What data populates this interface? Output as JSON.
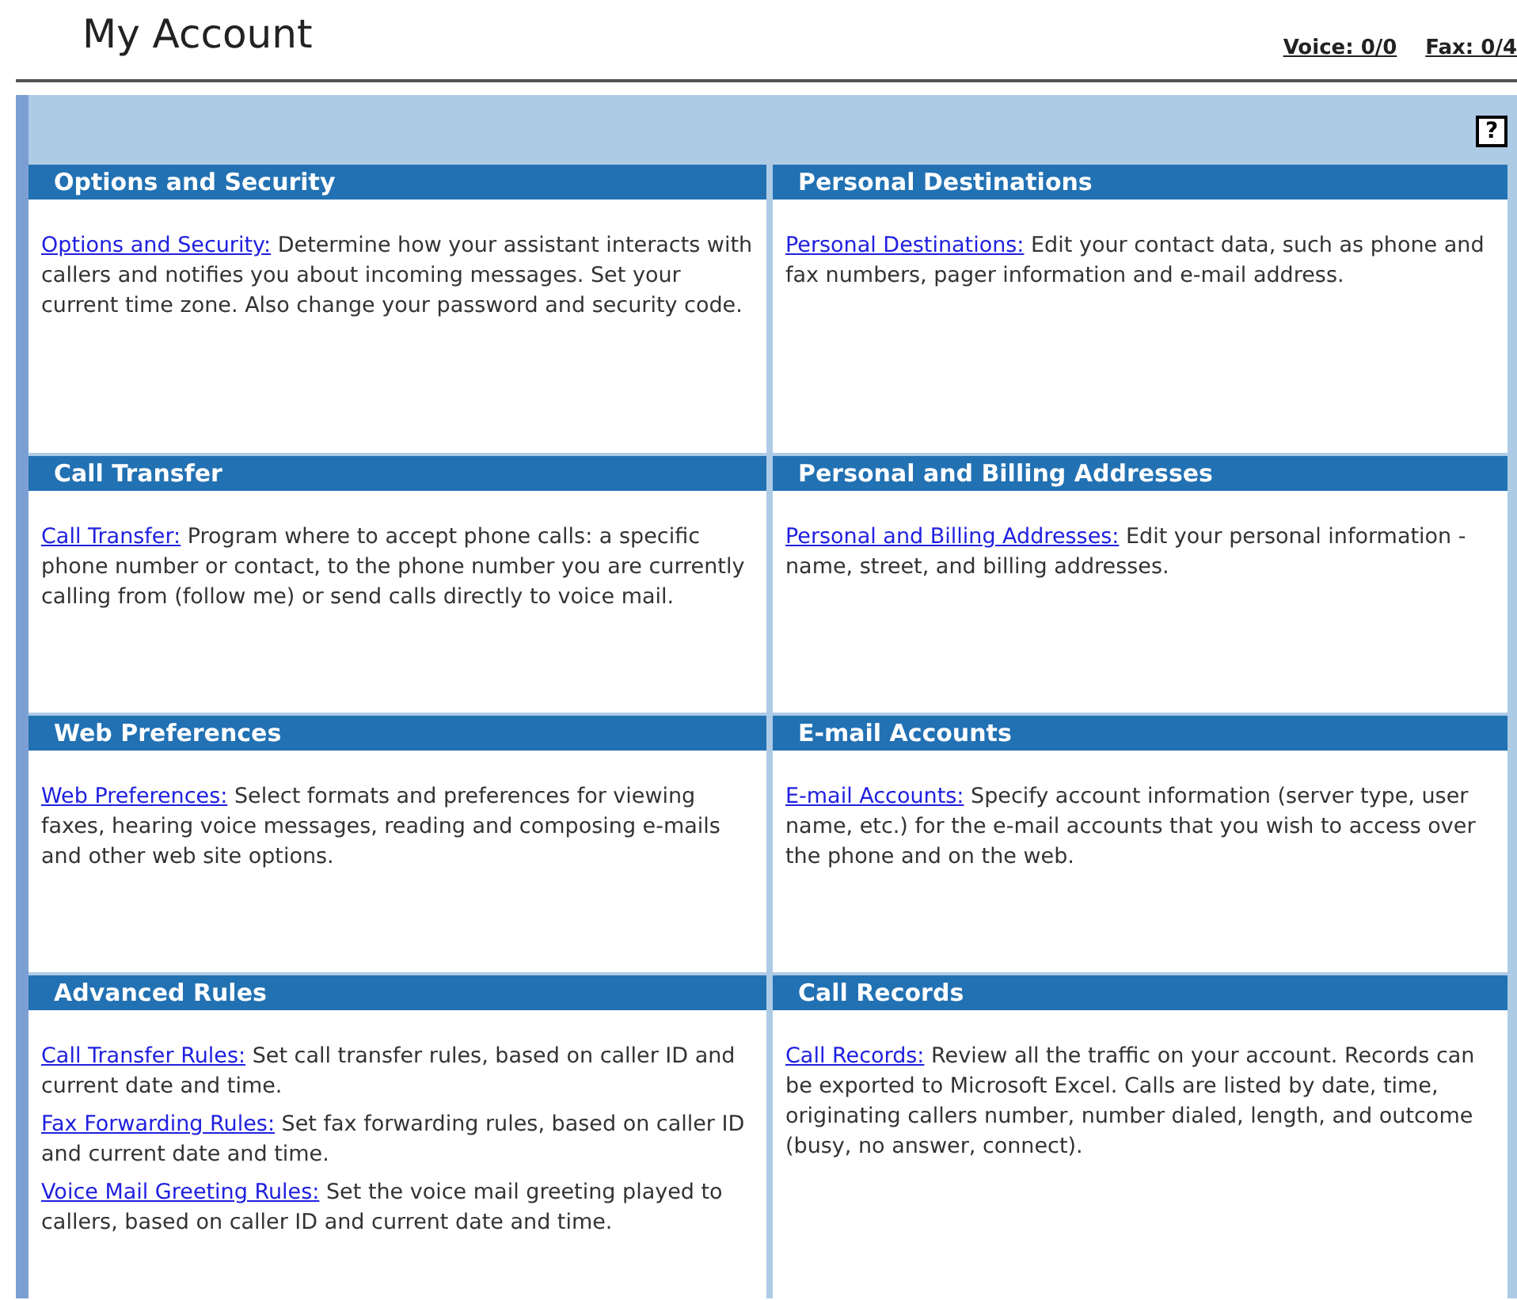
{
  "page_title": "My Account",
  "counters": [
    {
      "label": "Voice: 0/0"
    },
    {
      "label": "Fax: 0/4"
    }
  ],
  "help_button": {
    "label": "?"
  },
  "sections": [
    {
      "title": "Options and Security",
      "entries": [
        {
          "link": "Options and Security:",
          "text": " Determine how your assistant interacts with callers and notifies you about incoming messages. Set your current time zone. Also change your password and security code."
        }
      ]
    },
    {
      "title": "Personal Destinations",
      "entries": [
        {
          "link": "Personal Destinations:",
          "text": " Edit your contact data, such as phone and fax numbers, pager information and e-mail address."
        }
      ]
    },
    {
      "title": "Call Transfer",
      "entries": [
        {
          "link": "Call Transfer:",
          "text": " Program where to accept phone calls: a specific phone number or contact, to the phone number you are currently calling from (follow me) or send calls directly to voice mail."
        }
      ]
    },
    {
      "title": "Personal and Billing Addresses",
      "entries": [
        {
          "link": "Personal and Billing Addresses:",
          "text": " Edit your personal information - name, street, and billing addresses."
        }
      ]
    },
    {
      "title": "Web Preferences",
      "entries": [
        {
          "link": "Web Preferences:",
          "text": " Select formats and preferences for viewing faxes, hearing voice messages, reading and composing e-mails and other web site options."
        }
      ]
    },
    {
      "title": "E-mail Accounts",
      "entries": [
        {
          "link": "E-mail Accounts:",
          "text": " Specify account information (server type, user name, etc.) for the e-mail accounts that you wish to access over the phone and on the web."
        }
      ]
    },
    {
      "title": "Advanced Rules",
      "entries": [
        {
          "link": "Call Transfer Rules:",
          "text": " Set call transfer rules, based on caller ID and current date and time."
        },
        {
          "link": "Fax Forwarding Rules:",
          "text": " Set fax forwarding rules, based on caller ID and current date and time."
        },
        {
          "link": "Voice Mail Greeting Rules:",
          "text": " Set the voice mail greeting played to callers, based on caller ID and current date and time."
        }
      ]
    },
    {
      "title": "Call Records",
      "entries": [
        {
          "link": "Call Records:",
          "text": " Review all the traffic on your account. Records can be exported to Microsoft Excel. Calls are listed by date, time, originating callers number, number dialed, length, and outcome (busy, no answer, connect)."
        }
      ]
    }
  ]
}
